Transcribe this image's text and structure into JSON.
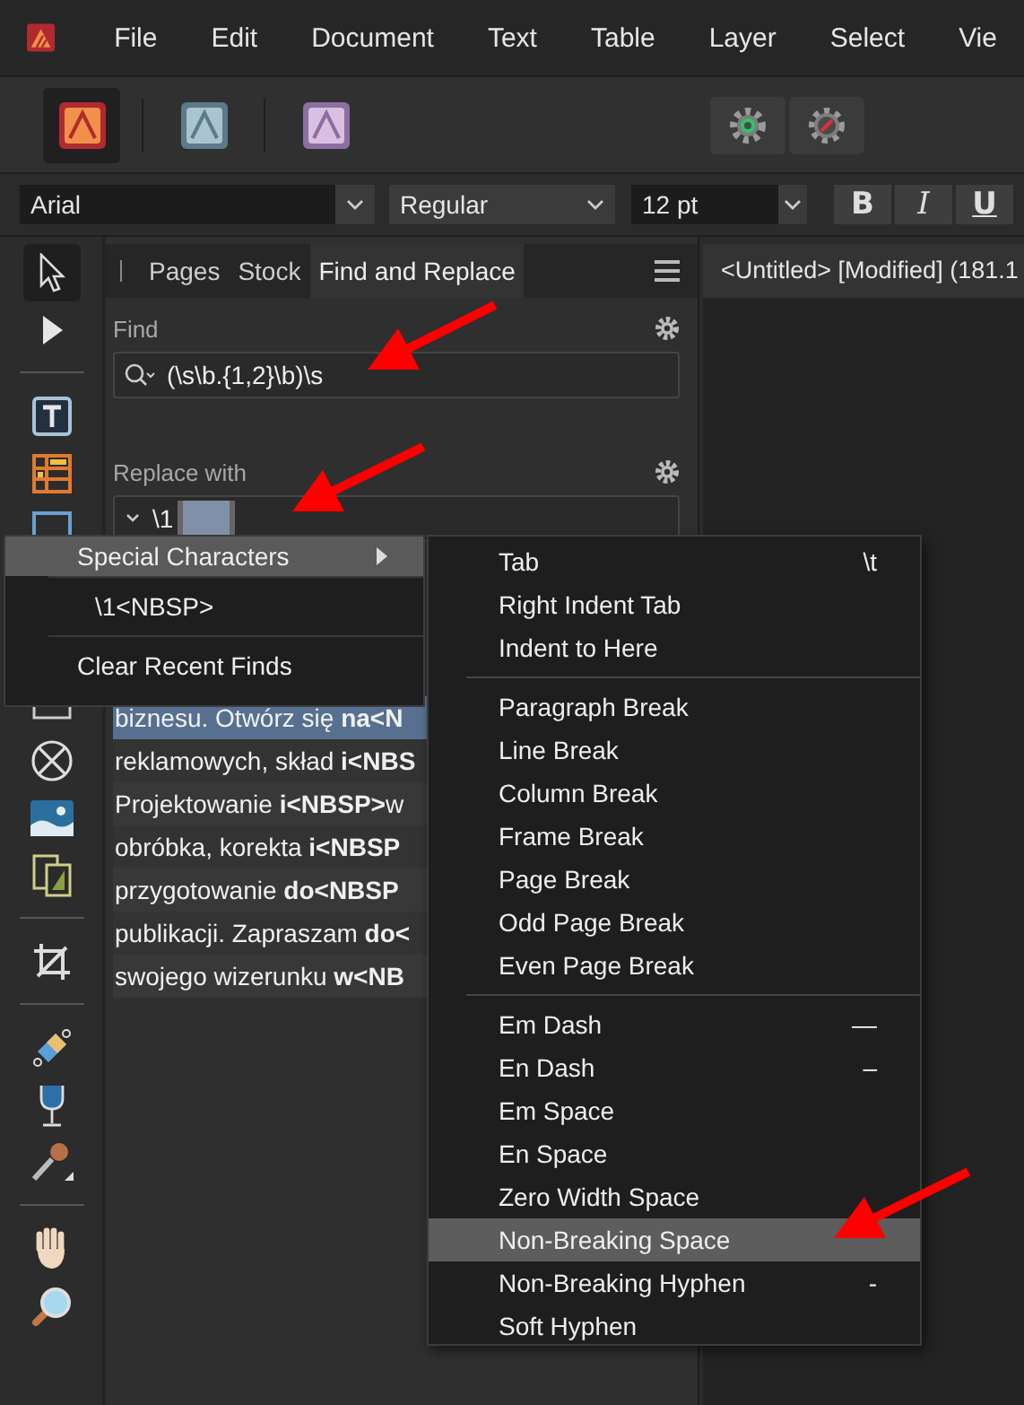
{
  "menu_bar": {
    "items": [
      "File",
      "Edit",
      "Document",
      "Text",
      "Table",
      "Layer",
      "Select",
      "Vie"
    ]
  },
  "personas": [
    {
      "kind": "publisher",
      "selected": true
    },
    {
      "kind": "designer",
      "selected": false
    },
    {
      "kind": "photo",
      "selected": false
    }
  ],
  "context_toolbar": {
    "font_family": "Arial",
    "font_style": "Regular",
    "font_size": "12 pt",
    "style_buttons": [
      "B",
      "I",
      "U"
    ]
  },
  "panel": {
    "tabs": [
      {
        "label": "Pages",
        "selected": false
      },
      {
        "label": "Stock",
        "selected": false
      },
      {
        "label": "Find and Replace",
        "selected": true
      }
    ],
    "find": {
      "label": "Find",
      "value": "(\\s\\b.{1,2}\\b)\\s"
    },
    "replace": {
      "label": "Replace with",
      "value": "\\1"
    },
    "results": [
      {
        "text": "biznesu. Otwórz się **na<N**",
        "selected": true
      },
      {
        "text": "reklamowych, skład **i<NBS**",
        "selected": false
      },
      {
        "text": "Projektowanie **i<NBSP>**w",
        "selected": false
      },
      {
        "text": "obróbka, korekta **i<NBSP**",
        "selected": false
      },
      {
        "text": "przygotowanie **do<NBSP**",
        "selected": false
      },
      {
        "text": "publikacji. Zapraszam **do<**",
        "selected": false
      },
      {
        "text": "swojego wizerunku **w<NB**",
        "selected": false
      }
    ]
  },
  "document_tab": {
    "title": "<Untitled> [Modified] (181.1"
  },
  "context_menu": {
    "items": [
      {
        "kind": "submenu",
        "label": "Special Characters",
        "selected": true
      },
      {
        "kind": "recent",
        "label": "\\1<NBSP>",
        "selected": false
      },
      {
        "kind": "action",
        "label": "Clear Recent Finds",
        "selected": false
      }
    ]
  },
  "submenu": {
    "groups": [
      [
        {
          "label": "Tab",
          "shortcut": "\\t",
          "selected": false
        },
        {
          "label": "Right Indent Tab",
          "selected": false
        },
        {
          "label": "Indent to Here",
          "selected": false
        }
      ],
      [
        {
          "label": "Paragraph Break",
          "selected": false
        },
        {
          "label": "Line Break",
          "selected": false
        },
        {
          "label": "Column Break",
          "selected": false
        },
        {
          "label": "Frame Break",
          "selected": false
        },
        {
          "label": "Page Break",
          "selected": false
        },
        {
          "label": "Odd Page Break",
          "selected": false
        },
        {
          "label": "Even Page Break",
          "selected": false
        }
      ],
      [
        {
          "label": "Em Dash",
          "shortcut": "—",
          "selected": false
        },
        {
          "label": "En Dash",
          "shortcut": "–",
          "selected": false
        },
        {
          "label": "Em Space",
          "selected": false
        },
        {
          "label": "En Space",
          "selected": false
        },
        {
          "label": "Zero Width Space",
          "selected": false
        },
        {
          "label": "Non-Breaking Space",
          "selected": true
        },
        {
          "label": "Non-Breaking Hyphen",
          "shortcut": "-",
          "selected": false
        },
        {
          "label": "Soft Hyphen",
          "selected": false
        }
      ]
    ]
  }
}
